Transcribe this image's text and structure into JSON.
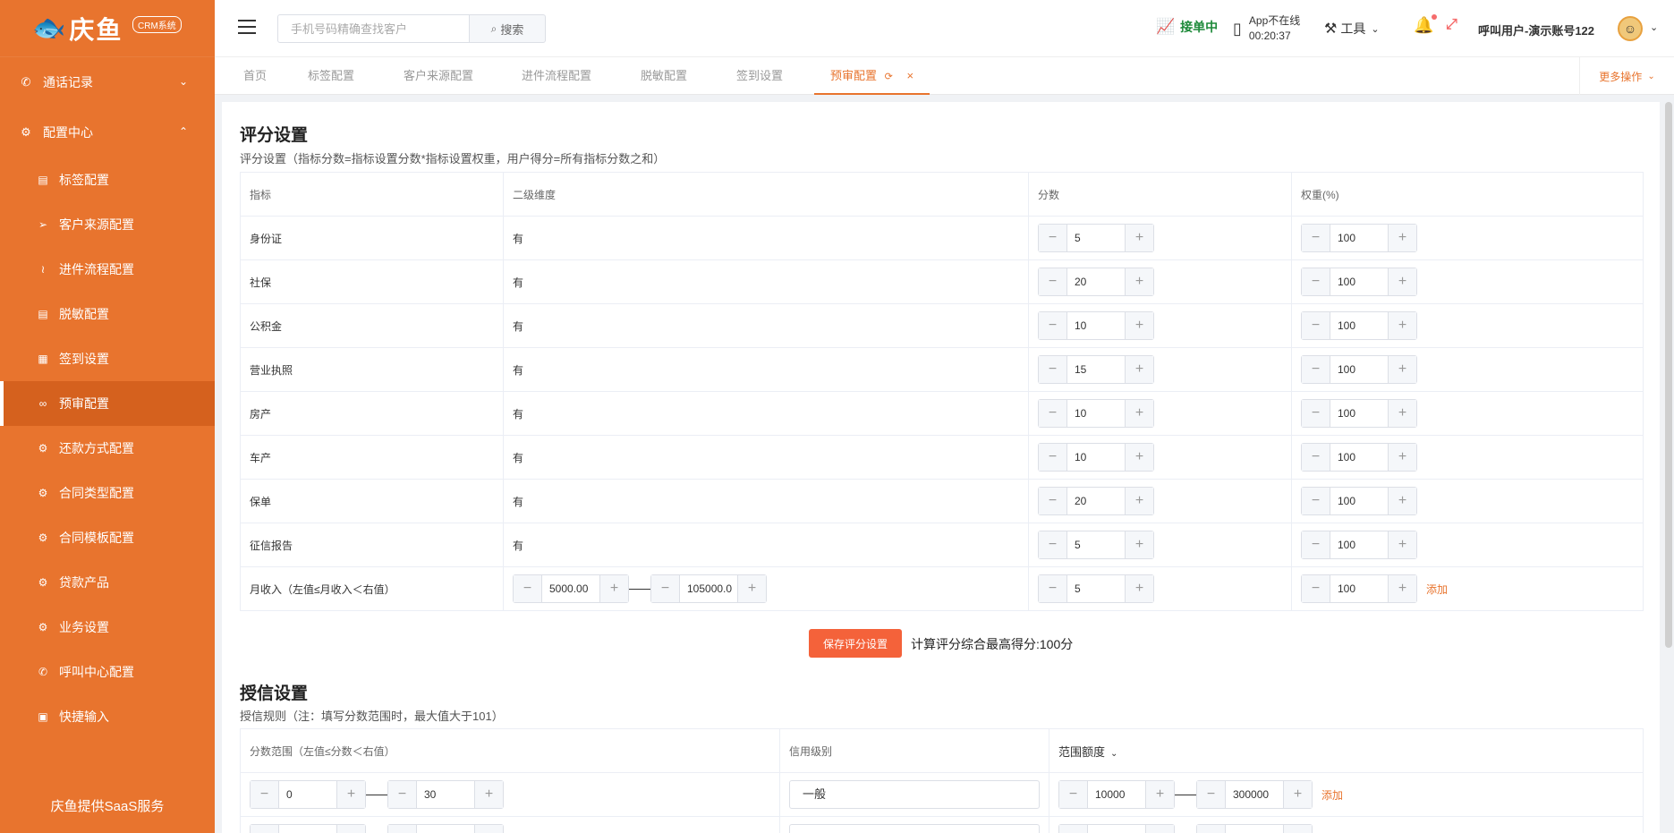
{
  "brand": {
    "name": "庆鱼",
    "badge": "CRM系统",
    "footer": "庆鱼提供SaaS服务"
  },
  "sidebar": {
    "groups": [
      {
        "label": "通话记录",
        "icon": "phone-icon"
      },
      {
        "label": "配置中心",
        "icon": "gear-icon"
      }
    ],
    "items": [
      {
        "label": "标签配置",
        "icon": "document-icon"
      },
      {
        "label": "客户来源配置",
        "icon": "send-icon"
      },
      {
        "label": "进件流程配置",
        "icon": "flow-icon"
      },
      {
        "label": "脱敏配置",
        "icon": "document-icon"
      },
      {
        "label": "签到设置",
        "icon": "qrcode-icon"
      },
      {
        "label": "预审配置",
        "icon": "glasses-icon"
      },
      {
        "label": "还款方式配置",
        "icon": "gear-icon"
      },
      {
        "label": "合同类型配置",
        "icon": "gear-icon"
      },
      {
        "label": "合同模板配置",
        "icon": "gear-icon"
      },
      {
        "label": "贷款产品",
        "icon": "gear-icon"
      },
      {
        "label": "业务设置",
        "icon": "gear-icon"
      },
      {
        "label": "呼叫中心配置",
        "icon": "phone-icon"
      },
      {
        "label": "快捷输入",
        "icon": "keyboard-icon"
      }
    ]
  },
  "header": {
    "search_placeholder": "手机号码精确查找客户",
    "search_button": "搜索",
    "status": "接单中",
    "app_line1": "App不在线",
    "app_line2": "00:20:37",
    "tools": "工具",
    "user": "呼叫用户-演示账号122"
  },
  "tabs": {
    "items": [
      "首页",
      "标签配置",
      "客户来源配置",
      "进件流程配置",
      "脱敏配置",
      "签到设置"
    ],
    "active": "预审配置",
    "more": "更多操作"
  },
  "score": {
    "title": "评分设置",
    "subtitle": "评分设置（指标分数=指标设置分数*指标设置权重，用户得分=所有指标分数之和）",
    "headers": [
      "指标",
      "二级维度",
      "分数",
      "权重(%)"
    ],
    "rows": [
      {
        "name": "身份证",
        "dim": "有",
        "score": "5",
        "weight": "100"
      },
      {
        "name": "社保",
        "dim": "有",
        "score": "20",
        "weight": "100"
      },
      {
        "name": "公积金",
        "dim": "有",
        "score": "10",
        "weight": "100"
      },
      {
        "name": "营业执照",
        "dim": "有",
        "score": "15",
        "weight": "100"
      },
      {
        "name": "房产",
        "dim": "有",
        "score": "10",
        "weight": "100"
      },
      {
        "name": "车产",
        "dim": "有",
        "score": "10",
        "weight": "100"
      },
      {
        "name": "保单",
        "dim": "有",
        "score": "20",
        "weight": "100"
      },
      {
        "name": "征信报告",
        "dim": "有",
        "score": "5",
        "weight": "100"
      }
    ],
    "income": {
      "name": "月收入（左值≤月收入＜右值）",
      "min": "5000.00",
      "max": "105000.0",
      "score": "5",
      "weight": "100",
      "add": "添加"
    },
    "save_button": "保存评分设置",
    "max_note": "计算评分综合最高得分:100分"
  },
  "credit": {
    "title": "授信设置",
    "subtitle": "授信规则（注：填写分数范围时，最大值大于101）",
    "headers": [
      "分数范围（左值≤分数＜右值）",
      "信用级别",
      "范围额度"
    ],
    "rows": [
      {
        "min": "0",
        "max": "30",
        "level": "一般",
        "amount_min": "10000",
        "amount_max": "300000",
        "add": "添加"
      }
    ]
  }
}
